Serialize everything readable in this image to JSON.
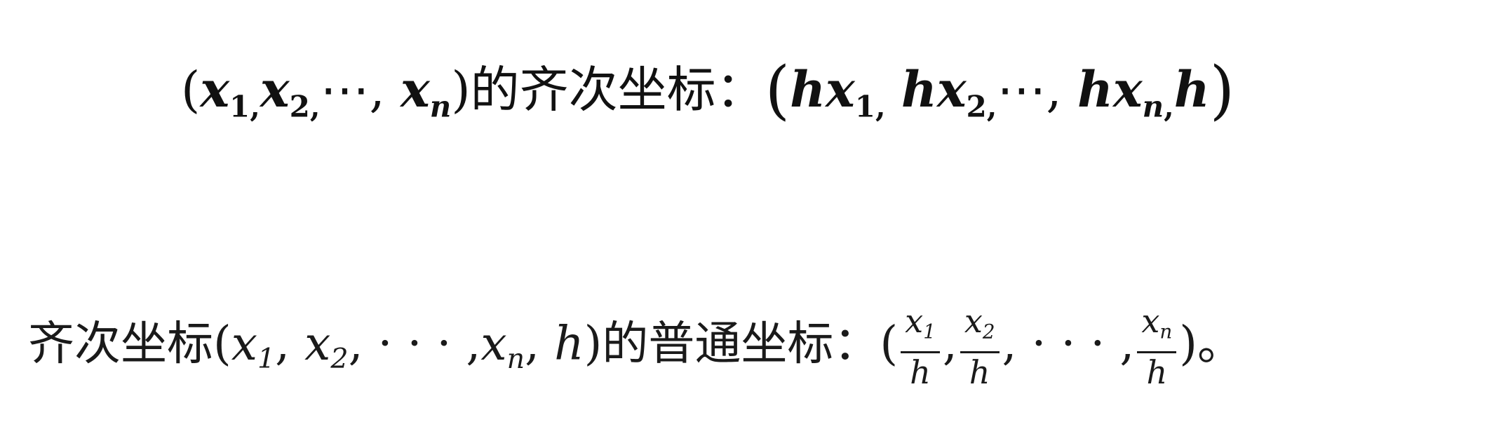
{
  "line1": {
    "open": "(",
    "x": "x",
    "sub1": "1",
    "sub2": "2",
    "subn": "n",
    "comma": ",",
    "dots": "⋯",
    "close": ")",
    "label": "的齐次坐标：",
    "bigopen": "(",
    "h": "h",
    "bigclose": ")"
  },
  "line2": {
    "label_start": "齐次坐标",
    "open": "(",
    "x": "x",
    "sub1": "1",
    "sub2": "2",
    "subn": "n",
    "comma": ",",
    "dots": "· · ·",
    "h": "h",
    "close": ")",
    "label_mid": "的普通坐标：",
    "paren_open": "(",
    "paren_close": ")",
    "end": "。"
  }
}
